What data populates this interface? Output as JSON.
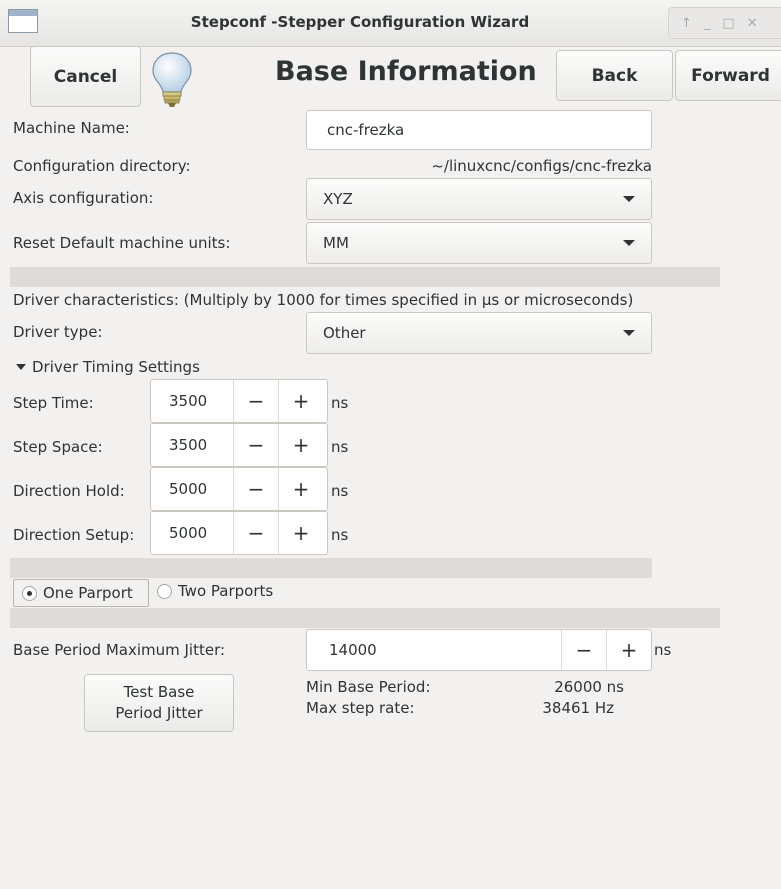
{
  "window": {
    "title": "Stepconf -Stepper Configuration Wizard",
    "controls": [
      "↑",
      "_",
      "□",
      "✕"
    ]
  },
  "header": {
    "cancel_label": "Cancel",
    "title": "Base Information",
    "back_label": "Back",
    "forward_label": "Forward"
  },
  "machine_name": {
    "label": "Machine Name:",
    "value": "cnc-frezka"
  },
  "config_dir": {
    "label": "Configuration directory:",
    "value": "~/linuxcnc/configs/cnc-frezka"
  },
  "axis_config": {
    "label": "Axis configuration:",
    "value": "XYZ"
  },
  "units": {
    "label": "Reset Default machine units:",
    "value": "MM"
  },
  "driver_chars": "Driver characteristics: (Multiply by 1000 for times specified in µs or microseconds)",
  "driver_type": {
    "label": "Driver type:",
    "value": "Other"
  },
  "timing": {
    "expander_label": "Driver Timing Settings",
    "rows": [
      {
        "label": "Step Time:",
        "value": "3500",
        "unit": "ns"
      },
      {
        "label": "Step Space:",
        "value": "3500",
        "unit": "ns"
      },
      {
        "label": "Direction Hold:",
        "value": "5000",
        "unit": "ns"
      },
      {
        "label": "Direction Setup:",
        "value": "5000",
        "unit": "ns"
      }
    ],
    "minus": "−",
    "plus": "+"
  },
  "parport": {
    "one_label": "One Parport",
    "two_label": "Two Parports",
    "selected": "one"
  },
  "jitter": {
    "label": "Base Period Maximum Jitter:",
    "value": "14000",
    "unit": "ns",
    "minus": "−",
    "plus": "+"
  },
  "test_button": {
    "line1": "Test Base",
    "line2": "Period Jitter"
  },
  "stats": {
    "min_base_period_label": "Min Base Period:",
    "min_base_period_value": "26000 ns",
    "max_step_rate_label": "Max step rate:",
    "max_step_rate_value": "38461 Hz"
  }
}
